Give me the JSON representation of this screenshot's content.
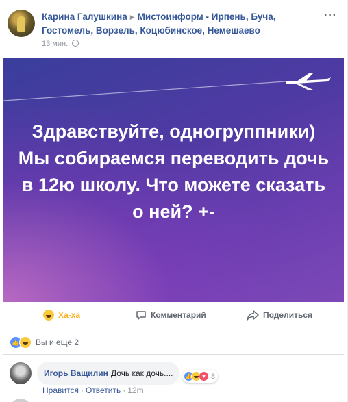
{
  "post": {
    "author": "Карина Галушкина",
    "group": "Мистоинформ - Ирпень, Буча, Гостомель, Ворзель, Коцюбинское, Немешаево",
    "time": "13 мин.",
    "more_icon": "ellipsis-icon",
    "banner_text": "Здравствуйте, одногруппники) Мы собираемся переводить дочь в 12ю школу. Что можете сказать о ней? +-",
    "banner_colors": {
      "start": "#3a3e9c",
      "mid": "#6a3eb0",
      "glow": "#d278c8"
    }
  },
  "actions": {
    "haha": "Ха-ха",
    "comment": "Комментарий",
    "share": "Поделиться"
  },
  "reactions": {
    "summary": "Вы и еще 2",
    "icons": [
      "like-icon",
      "haha-icon"
    ]
  },
  "comment": {
    "author": "Игорь Ващилин",
    "text": "Дочь как дочь....",
    "reaction_count": "8",
    "like": "Нравится",
    "reply": "Ответить",
    "time": "12m"
  },
  "colors": {
    "link": "#365899",
    "haha": "#f7b125",
    "like": "#5890ff",
    "love": "#f25268"
  }
}
